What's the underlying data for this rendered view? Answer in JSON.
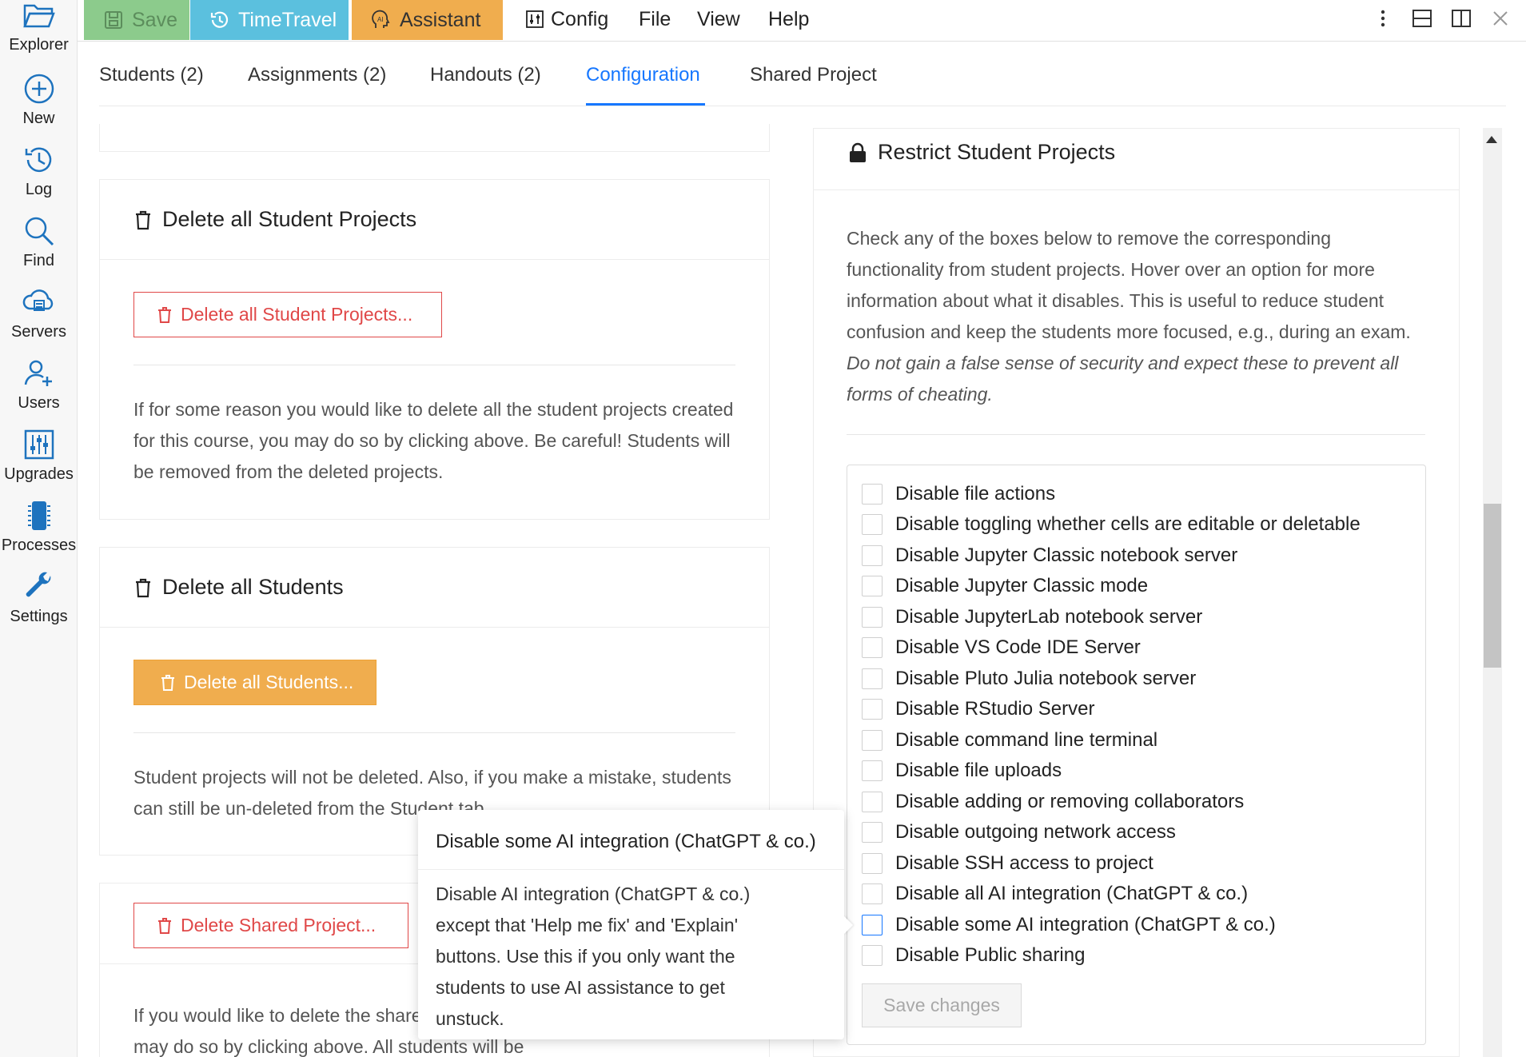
{
  "sidebar": {
    "items": [
      {
        "label": "Explorer",
        "icon": "folder-open-icon"
      },
      {
        "label": "New",
        "icon": "plus-circle-icon"
      },
      {
        "label": "Log",
        "icon": "history-icon"
      },
      {
        "label": "Find",
        "icon": "search-icon"
      },
      {
        "label": "Servers",
        "icon": "cloud-server-icon"
      },
      {
        "label": "Users",
        "icon": "users-icon"
      },
      {
        "label": "Upgrades",
        "icon": "sliders-icon"
      },
      {
        "label": "Processes",
        "icon": "chip-icon"
      },
      {
        "label": "Settings",
        "icon": "wrench-icon"
      }
    ]
  },
  "toolbar": {
    "save_label": "Save",
    "timetravel_label": "TimeTravel",
    "assistant_label": "Assistant",
    "config_label": "Config",
    "file_label": "File",
    "view_label": "View",
    "help_label": "Help"
  },
  "tabs": [
    {
      "label": "Students (2)"
    },
    {
      "label": "Assignments (2)"
    },
    {
      "label": "Handouts (2)"
    },
    {
      "label": "Configuration",
      "active": true
    },
    {
      "label": "Shared Project"
    }
  ],
  "delete_projects": {
    "title": "Delete all Student Projects",
    "button": "Delete all Student Projects...",
    "text": "If for some reason you would like to delete all the student projects created for this course, you may do so by clicking above. Be careful! Students will be removed from the deleted projects."
  },
  "delete_students": {
    "title": "Delete all Students",
    "button": "Delete all Students...",
    "text": "Student projects will not be deleted. Also, if you make a mistake, students can still be un-deleted from the Student tab."
  },
  "delete_shared": {
    "button": "Delete Shared Project...",
    "text": "If you would like to delete the shared project created for this course, you may do so by clicking above. All students will be"
  },
  "restrict": {
    "title": "Restrict Student Projects",
    "desc_plain": "Check any of the boxes below to remove the corresponding functionality from student projects. Hover over an option for more information about what it disables. This is useful to reduce student confusion and keep the students more focused, e.g., during an exam.",
    "desc_italic": "Do not gain a false sense of security and expect these to prevent all forms of cheating.",
    "options": [
      "Disable file actions",
      "Disable toggling whether cells are editable or deletable",
      "Disable Jupyter Classic notebook server",
      "Disable Jupyter Classic mode",
      "Disable JupyterLab notebook server",
      "Disable VS Code IDE Server",
      "Disable Pluto Julia notebook server",
      "Disable RStudio Server",
      "Disable command line terminal",
      "Disable file uploads",
      "Disable adding or removing collaborators",
      "Disable outgoing network access",
      "Disable SSH access to project",
      "Disable all AI integration (ChatGPT & co.)",
      "Disable some AI integration (ChatGPT & co.)",
      "Disable Public sharing"
    ],
    "save_label": "Save changes"
  },
  "tooltip": {
    "title": "Disable some AI integration (ChatGPT & co.)",
    "body": "Disable AI integration (ChatGPT & co.) except that 'Help me fix' and 'Explain' buttons. Use this if you only want the students to use AI assistance to get unstuck."
  },
  "colors": {
    "accent": "#1677ff",
    "danger": "#e04848",
    "warning": "#f0ad4e",
    "save_green": "#8ccb8c",
    "timetravel_blue": "#5bc0de"
  }
}
